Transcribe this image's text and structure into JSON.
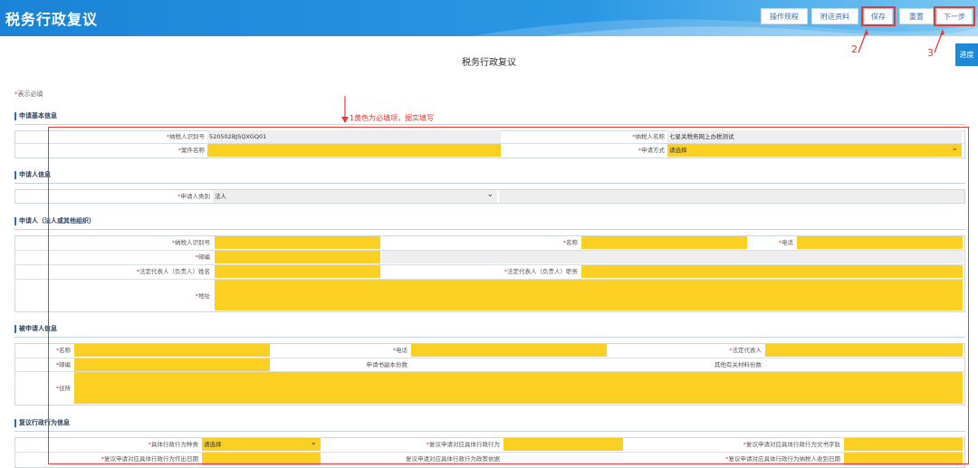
{
  "header": {
    "title": "税务行政复议",
    "buttons": [
      {
        "label": "操作规程"
      },
      {
        "label": "附送资料"
      },
      {
        "label": "保存"
      },
      {
        "label": "重置"
      },
      {
        "label": "下一步"
      }
    ]
  },
  "annotations": {
    "a1": "1黄色为必填项，据实填写",
    "a2": "2",
    "a3": "3"
  },
  "progress_label": "进度",
  "page_title": "税务行政复议",
  "required_note": {
    "star": "*",
    "text": "表示必填"
  },
  "sections": {
    "basic": "申请基本信息",
    "applicant_info": "申请人信息",
    "applicant_org": "申请人（法人或其他组织）",
    "respondent": "被申请人信息",
    "review": "复议行政行为信息"
  },
  "basic": {
    "taxpayer_id_label": "纳税人识别号",
    "taxpayer_id_value": "520502BJSQXGQ01",
    "taxpayer_name_label": "纳税人名称",
    "taxpayer_name_value": "七星关税务网上办税测试",
    "case_name_label": "案件名称",
    "apply_method_label": "申请方式",
    "apply_method_value": "请选择"
  },
  "applicant_info": {
    "type_label": "申请人类别",
    "type_value": "法人"
  },
  "applicant_org": {
    "taxpayer_id_label": "纳税人识别号",
    "name_label": "名称",
    "phone_label": "电话",
    "postcode_label": "邮编",
    "legal_rep_name_label": "法定代表人（负责人）姓名",
    "legal_rep_title_label": "法定代表人（负责人）职务",
    "address_label": "地址"
  },
  "respondent": {
    "name_label": "名称",
    "phone_label": "电话",
    "legal_rep_label": "法定代表人",
    "postcode_label": "邮编",
    "copies_label": "申请书副本份数",
    "other_copies_label": "其他有关材料份数",
    "residence_label": "住所"
  },
  "review": {
    "act_type_label": "具体行政行为种类",
    "act_type_value": "请选择",
    "act_label": "复议申请对应具体行政行为",
    "doc_no_label": "复议申请对应具体行政行为文书字轨",
    "made_date_label": "复议申请对应具体行政行为作出日期",
    "basis_label": "复议申请对应具体行政行为政策依据",
    "received_date_label": "复议申请对应具体行政行为纳税人收到日期"
  },
  "colors": {
    "header": "#1a83d6",
    "required": "#fcd023",
    "annotation": "#e53935"
  }
}
